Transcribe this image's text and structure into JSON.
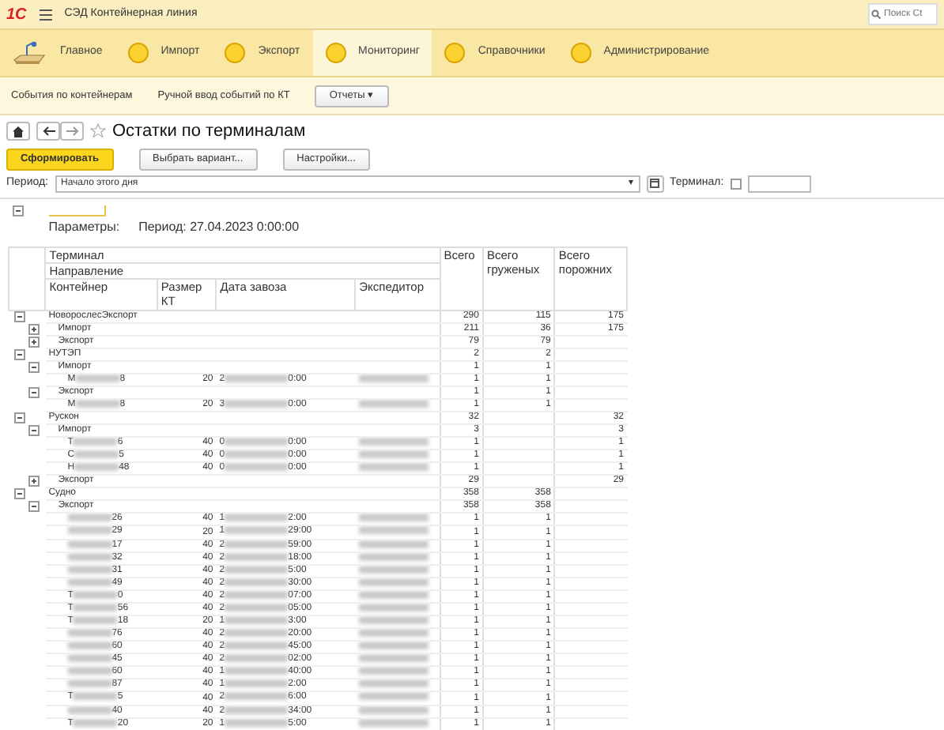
{
  "app": {
    "logo": "1С",
    "title": "СЭД Контейнерная линия",
    "search": {
      "placeholder": "Поиск Ct"
    }
  },
  "sections": [
    {
      "label": "Главное",
      "kind": "desk",
      "selected": false
    },
    {
      "label": "Импорт",
      "kind": "circle",
      "selected": false
    },
    {
      "label": "Экспорт",
      "kind": "circle",
      "selected": false
    },
    {
      "label": "Мониторинг",
      "kind": "circle",
      "selected": true
    },
    {
      "label": "Справочники",
      "kind": "circle",
      "selected": false
    },
    {
      "label": "Администрирование",
      "kind": "circle",
      "selected": false
    }
  ],
  "subnav": {
    "links": [
      "События по контейнерам",
      "Ручной ввод событий по КТ"
    ],
    "menu": {
      "label": "Отчеты",
      "caret": "▾"
    }
  },
  "form": {
    "title": "Остатки по терминалам",
    "favorite": false,
    "buttons": [
      {
        "label": "Сформировать",
        "kind": "primary"
      },
      {
        "label": "Выбрать вариант...",
        "kind": "default"
      },
      {
        "label": "Настройки...",
        "kind": "default"
      }
    ],
    "period": {
      "label": "Период:",
      "value": "Начало этого дня",
      "dropdown": "▾"
    },
    "terminal": {
      "label": "Терминал:",
      "checked": false
    }
  },
  "report": {
    "params_label": "Параметры:",
    "params_value": "Период: 27.04.2023 0:00:00",
    "headers": {
      "terminal": "Терминал",
      "direction": "Направление",
      "container": "Контейнер",
      "size": "Размер КТ",
      "date": "Дата завоза",
      "forwarder": "Экспедитор",
      "total": "Всего",
      "loaded": "Всего груженых",
      "empty": "Всего порожних"
    },
    "terminals": [
      {
        "name": "НоворослесЭкспорт",
        "expanded": true,
        "total": "290",
        "loaded": "115",
        "empty": "175",
        "directions": [
          {
            "name": "Импорт",
            "expanded": false,
            "total": "211",
            "loaded": "36",
            "empty": "175"
          },
          {
            "name": "Экспорт",
            "expanded": false,
            "total": "79",
            "loaded": "79"
          }
        ]
      },
      {
        "name": "НУТЭП",
        "expanded": true,
        "total": "2",
        "loaded": "2",
        "directions": [
          {
            "name": "Импорт",
            "expanded": true,
            "total": "1",
            "loaded": "1",
            "rows": [
              {
                "prefix": "М",
                "suffix": "8",
                "size": "20",
                "date_start": "2",
                "date_end": "0:00",
                "total": "1",
                "loaded": "1"
              }
            ]
          },
          {
            "name": "Экспорт",
            "expanded": true,
            "total": "1",
            "loaded": "1",
            "rows": [
              {
                "prefix": "М",
                "suffix": "8",
                "size": "20",
                "date_start": "3",
                "date_end": "0:00",
                "total": "1",
                "loaded": "1"
              }
            ]
          }
        ]
      },
      {
        "name": "Рускон",
        "expanded": true,
        "total": "32",
        "empty": "32",
        "directions": [
          {
            "name": "Импорт",
            "expanded": true,
            "total": "3",
            "empty": "3",
            "rows": [
              {
                "prefix": "Т",
                "suffix": "6",
                "size": "40",
                "date_start": "0",
                "date_end": "0:00",
                "total": "1",
                "empty": "1"
              },
              {
                "prefix": "С",
                "suffix": "5",
                "size": "40",
                "date_start": "0",
                "date_end": "0:00",
                "total": "1",
                "empty": "1"
              },
              {
                "prefix": "Н",
                "suffix": "48",
                "size": "40",
                "date_start": "0",
                "date_end": "0:00",
                "total": "1",
                "empty": "1"
              }
            ]
          },
          {
            "name": "Экспорт",
            "expanded": false,
            "total": "29",
            "empty": "29"
          }
        ]
      },
      {
        "name": "Судно",
        "expanded": true,
        "total": "358",
        "loaded": "358",
        "directions": [
          {
            "name": "Экспорт",
            "expanded": true,
            "total": "358",
            "loaded": "358",
            "rows": [
              {
                "suffix": "26",
                "size": "40",
                "date_start": "1",
                "date_end": "2:00",
                "total": "1",
                "loaded": "1"
              },
              {
                "suffix": "29",
                "size": "20",
                "date_start": "1",
                "date_end": "29:00",
                "total": "1",
                "loaded": "1"
              },
              {
                "suffix": "17",
                "size": "40",
                "date_start": "2",
                "date_end": "59:00",
                "total": "1",
                "loaded": "1"
              },
              {
                "suffix": "32",
                "size": "40",
                "date_start": "2",
                "date_end": "18:00",
                "total": "1",
                "loaded": "1"
              },
              {
                "suffix": "31",
                "size": "40",
                "date_start": "2",
                "date_end": "5:00",
                "total": "1",
                "loaded": "1"
              },
              {
                "suffix": "49",
                "size": "40",
                "date_start": "2",
                "date_end": "30:00",
                "total": "1",
                "loaded": "1"
              },
              {
                "prefix": "Т",
                "suffix": "0",
                "size": "40",
                "date_start": "2",
                "date_end": "07:00",
                "total": "1",
                "loaded": "1"
              },
              {
                "prefix": "Т",
                "suffix": "56",
                "size": "40",
                "date_start": "2",
                "date_end": "05:00",
                "total": "1",
                "loaded": "1"
              },
              {
                "prefix": "Т",
                "suffix": "18",
                "size": "20",
                "date_start": "1",
                "date_end": "3:00",
                "total": "1",
                "loaded": "1"
              },
              {
                "suffix": "76",
                "size": "40",
                "date_start": "2",
                "date_end": "20:00",
                "total": "1",
                "loaded": "1"
              },
              {
                "suffix": "60",
                "size": "40",
                "date_start": "2",
                "date_end": "45:00",
                "total": "1",
                "loaded": "1"
              },
              {
                "suffix": "45",
                "size": "40",
                "date_start": "2",
                "date_end": "02:00",
                "total": "1",
                "loaded": "1"
              },
              {
                "suffix": "60",
                "size": "40",
                "date_start": "1",
                "date_end": "40:00",
                "total": "1",
                "loaded": "1"
              },
              {
                "suffix": "87",
                "size": "40",
                "date_start": "1",
                "date_end": "2:00",
                "total": "1",
                "loaded": "1"
              },
              {
                "prefix": "Т",
                "suffix": "5",
                "size": "40",
                "date_start": "2",
                "date_end": "6:00",
                "total": "1",
                "loaded": "1"
              },
              {
                "suffix": "40",
                "size": "40",
                "date_start": "2",
                "date_end": "34:00",
                "total": "1",
                "loaded": "1"
              },
              {
                "prefix": "Т",
                "suffix": "20",
                "size": "20",
                "date_start": "1",
                "date_end": "5:00",
                "total": "1",
                "loaded": "1"
              }
            ]
          }
        ]
      }
    ]
  }
}
